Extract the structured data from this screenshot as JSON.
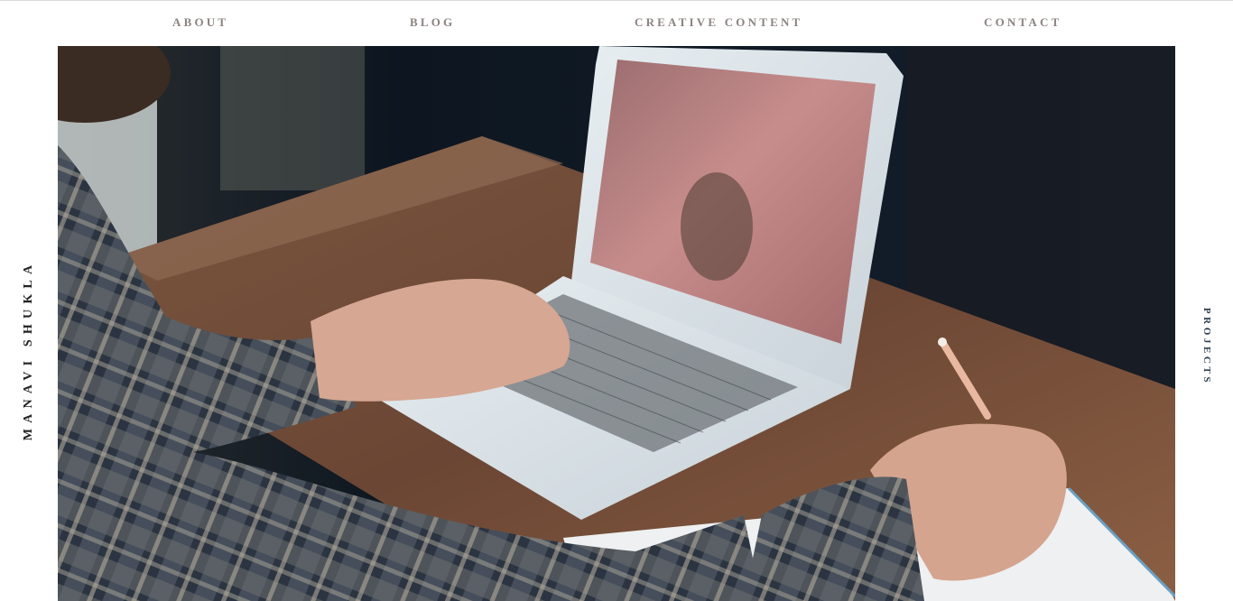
{
  "nav": {
    "about": "ABOUT",
    "blog": "BLOG",
    "creative_content": "CREATIVE CONTENT",
    "contact": "CONTACT"
  },
  "side": {
    "name": "MANAVI  SHUKLA",
    "projects": "PROJECTS"
  },
  "colors": {
    "nav_text": "#8b8380",
    "name_text": "#222222",
    "projects_text": "#2d3e4e",
    "background": "#ffffff"
  }
}
